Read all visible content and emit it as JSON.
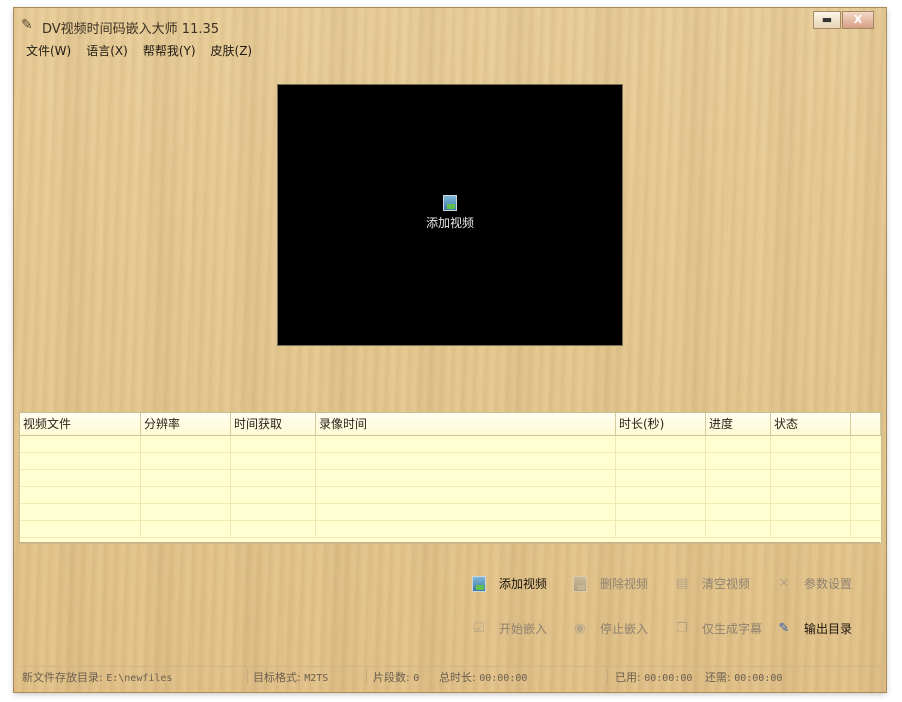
{
  "window": {
    "title": "DV视频时间码嵌入大师  11.35",
    "minimize_label": "▬",
    "close_label": "X"
  },
  "menu": [
    {
      "label": "文件(W)"
    },
    {
      "label": "语言(X)"
    },
    {
      "label": "帮帮我(Y)"
    },
    {
      "label": "皮肤(Z)"
    }
  ],
  "preview": {
    "add_label": "添加视频"
  },
  "table": {
    "columns": [
      "视频文件",
      "分辨率",
      "时间获取",
      "录像时间",
      "时长(秒)",
      "进度",
      "状态",
      ""
    ],
    "empty_rows": 6
  },
  "actions": {
    "add_video": "添加视频",
    "delete_video": "删除视频",
    "clear_video": "清空视频",
    "settings": "参数设置",
    "start_embed": "开始嵌入",
    "stop_embed": "停止嵌入",
    "gen_subtitle": "仅生成字幕",
    "output_dir": "输出目录"
  },
  "status": {
    "dir_label": "新文件存放目录:",
    "dir_value": "E:\\newfiles",
    "format_label": "目标格式:",
    "format_value": "M2TS",
    "segments_label": "片段数:",
    "segments_value": "0",
    "total_label": "总时长:",
    "total_value": "00:00:00",
    "used_label": "已用:",
    "used_value": "00:00:00",
    "remaining_label": "还需:",
    "remaining_value": "00:00:00"
  },
  "colors": {
    "wood": "#e6c992",
    "table_bg": "#ffffd2",
    "preview_bg": "#000000"
  }
}
